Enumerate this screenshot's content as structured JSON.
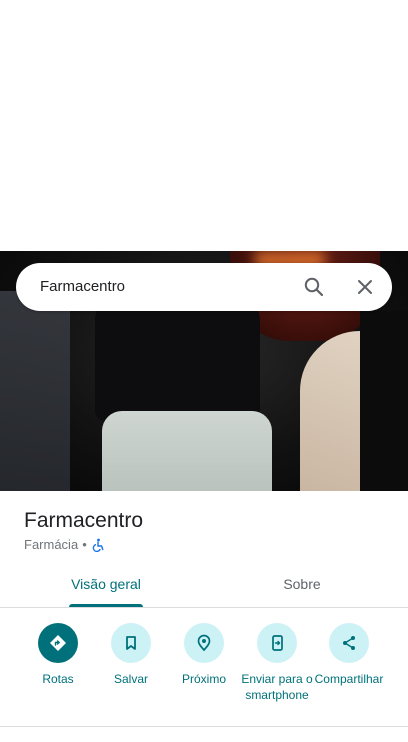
{
  "search": {
    "query": "Farmacentro",
    "search_icon": "search-icon",
    "close_icon": "close-icon"
  },
  "place": {
    "name": "Farmacentro",
    "category": "Farmácia",
    "separator": "•",
    "accessibility_icon": "wheelchair-icon"
  },
  "tabs": [
    {
      "label": "Visão geral",
      "active": true
    },
    {
      "label": "Sobre",
      "active": false
    }
  ],
  "actions": [
    {
      "label": "Rotas",
      "icon": "directions-icon",
      "primary": true
    },
    {
      "label": "Salvar",
      "icon": "bookmark-icon"
    },
    {
      "label": "Próximo",
      "icon": "nearby-icon"
    },
    {
      "label": "Enviar para o smartphone",
      "icon": "send-to-phone-icon"
    },
    {
      "label": "Compartilhar",
      "icon": "share-icon"
    }
  ],
  "colors": {
    "accent": "#00717a",
    "accent_light": "#cdf2f6",
    "text_secondary": "#70757a"
  }
}
